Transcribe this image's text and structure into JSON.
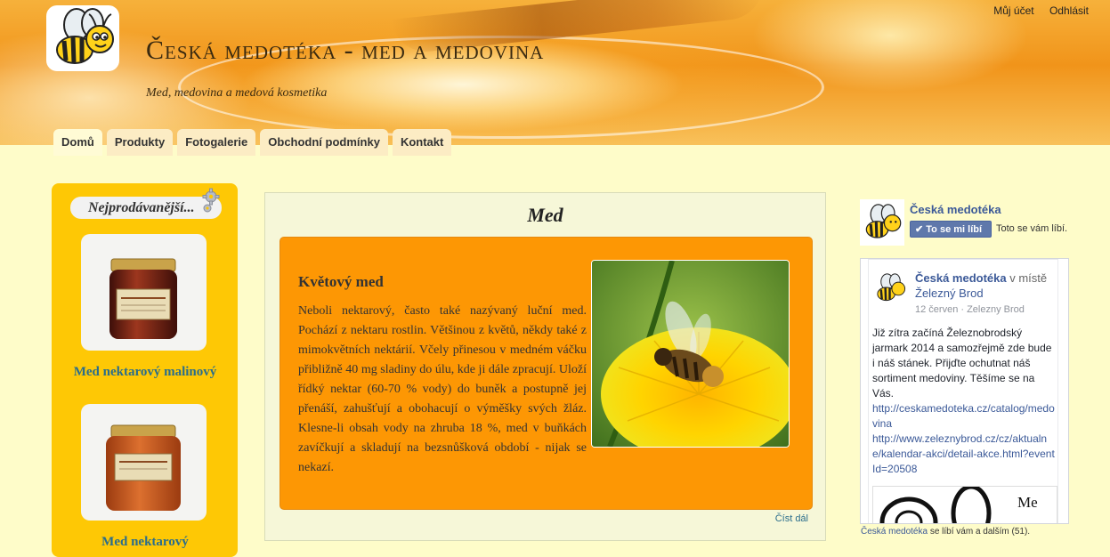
{
  "header": {
    "title": "Česká medotéka - med a medovina",
    "subtitle": "Med, medovina a medová kosmetika",
    "account_label": "Můj účet",
    "logout_label": "Odhlásit"
  },
  "nav": {
    "tabs": [
      {
        "label": "Domů",
        "active": true
      },
      {
        "label": "Produkty",
        "active": false
      },
      {
        "label": "Fotogalerie",
        "active": false
      },
      {
        "label": "Obchodní podmínky",
        "active": false
      },
      {
        "label": "Kontakt",
        "active": false
      }
    ]
  },
  "sidebar": {
    "box_title": "Nejprodávanější...",
    "products": [
      {
        "name": "Med nektarový malinový",
        "image": "honey-jar-raspberry"
      },
      {
        "name": "Med nektarový",
        "image": "honey-jar"
      }
    ]
  },
  "main": {
    "heading": "Med",
    "article_title": "Květový med",
    "article_text": "Neboli nektarový, často také nazývaný luční med. Pochází z nektaru rostlin. Většinou z květů, někdy také z mimokvětních nektárií. Včely přinesou v medném váčku přibližně 40 mg sladiny do úlu, kde ji dále zpracují. Uloží řídký nektar (60-70 % vody) do buněk a postupně jej přenáší, zahušťují a obohacují o výměšky svých žláz. Klesne-li obsah vody na zhruba 18 %, med v buňkách zavíčkují a skladují na bezsnůšková období - nijak se nekazí.",
    "article_image": "bee-on-dandelion",
    "read_more": "Číst dál"
  },
  "facebook": {
    "page_name": "Česká medotéka",
    "like_button": "To se mi líbí",
    "like_note": "Toto se vám líbí.",
    "post": {
      "author": "Česká medotéka",
      "author_suffix": " v místě ",
      "place": "Železný Brod",
      "date": "12 červen · Zelezny Brod",
      "text": "Již zítra začíná Železnobrodský jarmark 2014 a samozřejmě zde bude i náš stánek. Přijďte ochutnat náš sortiment medoviny. Těšíme se na Vás.",
      "link1": "http://ceskamedoteka.cz/catalog/medovina",
      "link2": "http://www.zeleznybrod.cz/cz/aktualne/kalendar-akci/detail-akce.html?eventId=20508",
      "media_title": "Me"
    },
    "footer_name": "Česká medotéka",
    "footer_text": " se líbí vám a dalším (51)."
  },
  "colors": {
    "page_bg": "#fefcc9",
    "sidebar_box": "#fec805",
    "article_box": "#fd9704",
    "product_link": "#2a6d8c",
    "fb_blue": "#3b5998"
  }
}
